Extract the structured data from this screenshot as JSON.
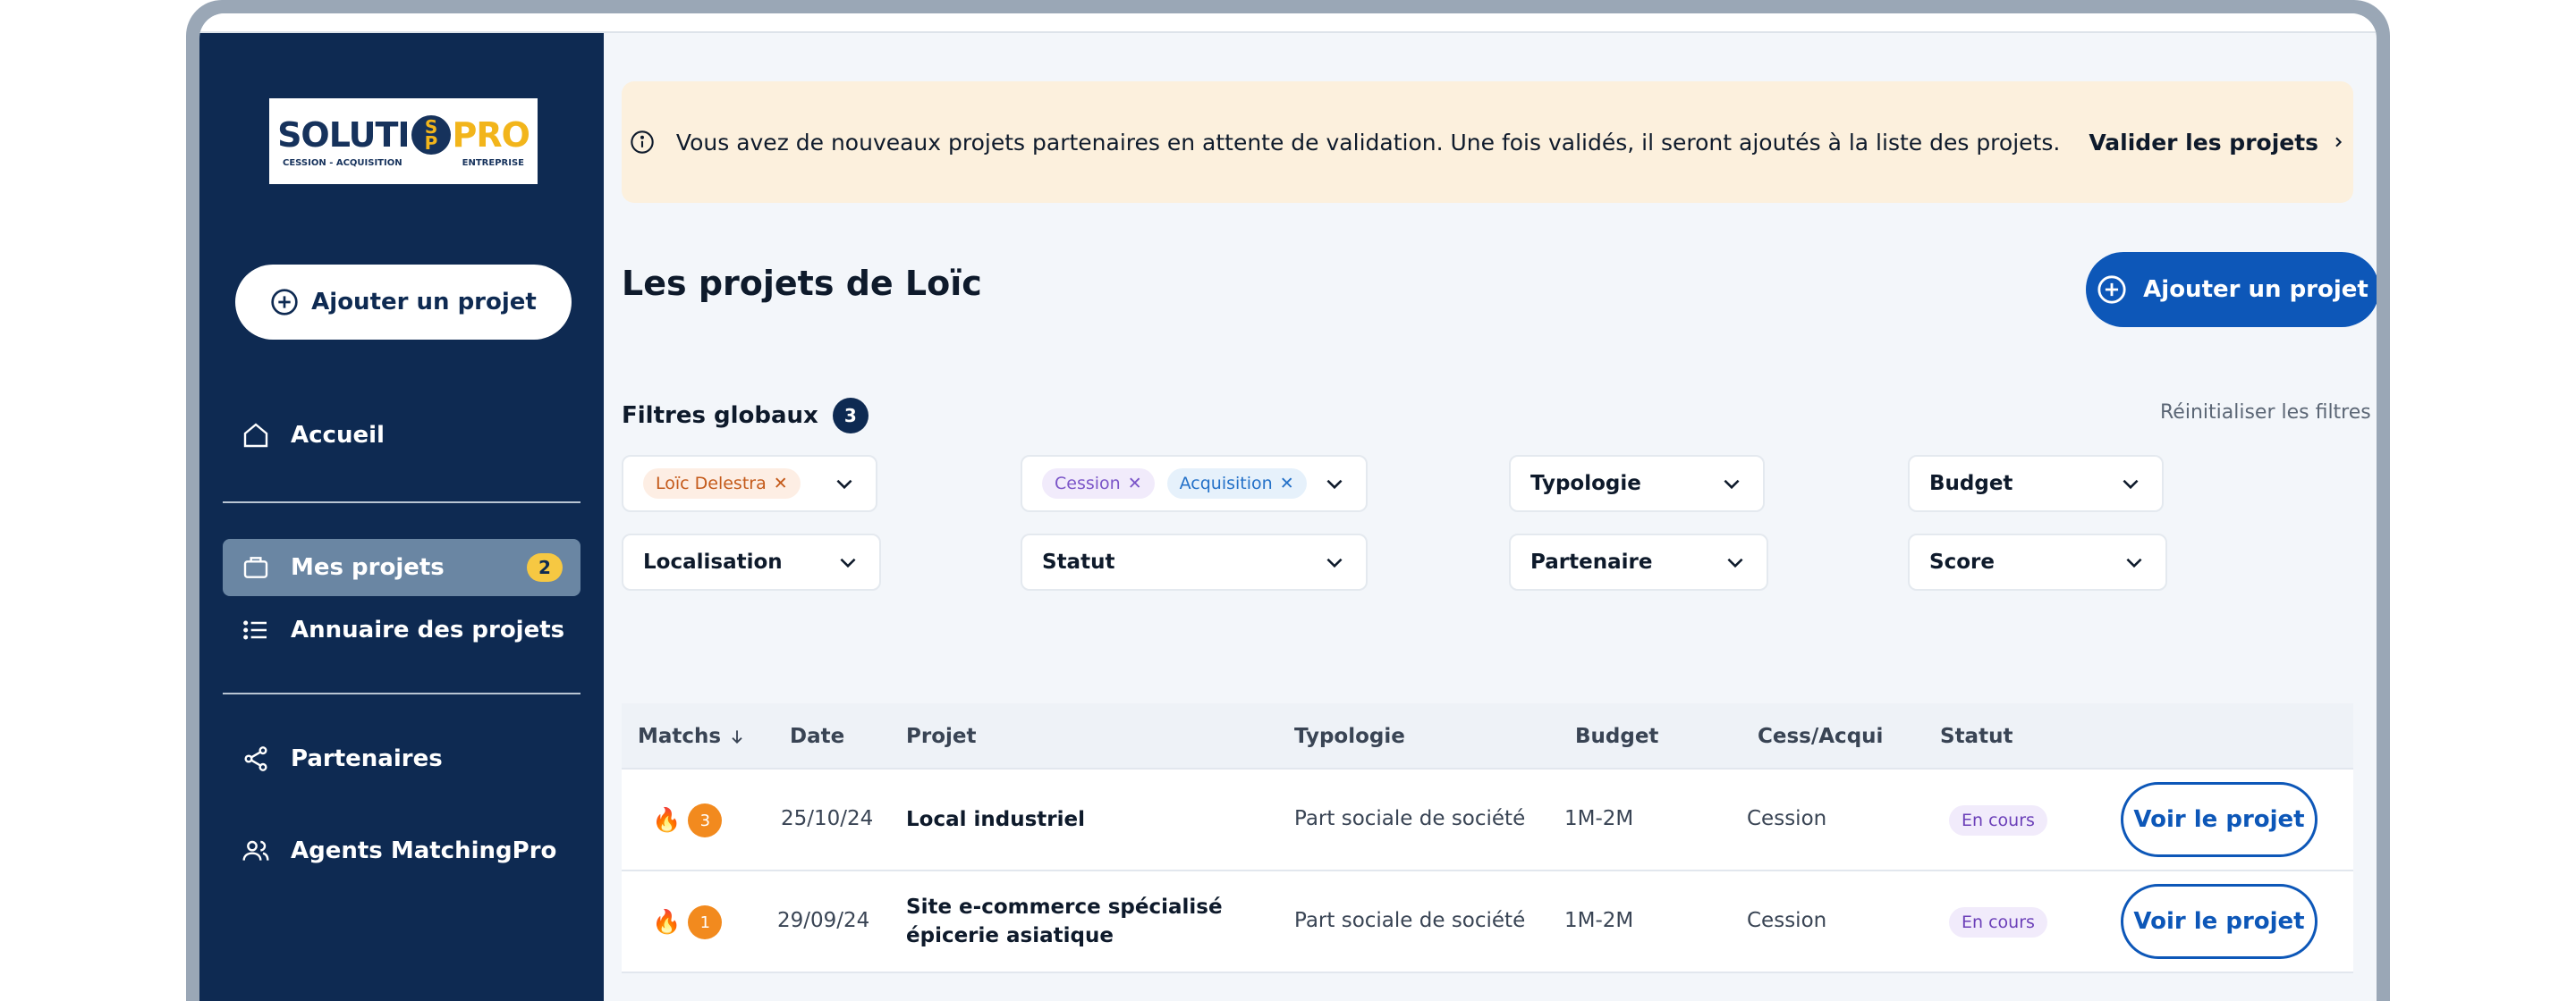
{
  "sidebar": {
    "logo": {
      "left": "SOLUTI",
      "pin_top": "S",
      "pin_bottom": "P",
      "right": "PRO",
      "sub_left": "CESSION - ACQUISITION",
      "sub_right": "ENTREPRISE"
    },
    "add_button": "Ajouter un projet",
    "items": [
      {
        "label": "Accueil",
        "icon": "home-icon"
      },
      {
        "label": "Mes projets",
        "icon": "briefcase-icon",
        "badge": "2",
        "active": true
      },
      {
        "label": "Annuaire des projets",
        "icon": "list-icon"
      },
      {
        "label": "Partenaires",
        "icon": "share-icon"
      },
      {
        "label": "Agents MatchingPro",
        "icon": "users-icon"
      }
    ]
  },
  "banner": {
    "text": "Vous avez de nouveaux projets partenaires en attente de validation. Une fois validés, il seront ajoutés à la liste des projets.",
    "link": "Valider les projets"
  },
  "main": {
    "title": "Les projets de Loïc",
    "add_button": "Ajouter un projet"
  },
  "filters": {
    "title": "Filtres globaux",
    "count": "3",
    "reset": "Réinitialiser les filtres",
    "owner_chip": "Loïc Delestra",
    "type_chips": [
      "Cession",
      "Acquisition"
    ],
    "typologie": "Typologie",
    "budget": "Budget",
    "localisation": "Localisation",
    "statut": "Statut",
    "partenaire": "Partenaire",
    "score": "Score"
  },
  "table": {
    "headers": {
      "matchs": "Matchs",
      "date": "Date",
      "projet": "Projet",
      "typologie": "Typologie",
      "budget": "Budget",
      "cess": "Cess/Acqui",
      "statut": "Statut"
    },
    "rows": [
      {
        "matchs": "3",
        "date": "25/10/24",
        "projet": "Local industriel",
        "projet2": "",
        "typologie": "Part sociale de société",
        "budget": "1M-2M",
        "cess": "Cession",
        "statut": "En cours",
        "action": "Voir le projet"
      },
      {
        "matchs": "1",
        "date": "29/09/24",
        "projet": "Site e-commerce spécialisé",
        "projet2": "épicerie asiatique",
        "typologie": "Part sociale de société",
        "budget": "1M-2M",
        "cess": "Cession",
        "statut": "En cours",
        "action": "Voir le projet"
      }
    ]
  },
  "colors": {
    "sidebar": "#0e2a52",
    "primary": "#0d57b8",
    "banner": "#fcf0dd",
    "active_item": "#6a86a3",
    "badge": "#f6c842",
    "match": "#f28a1e"
  }
}
